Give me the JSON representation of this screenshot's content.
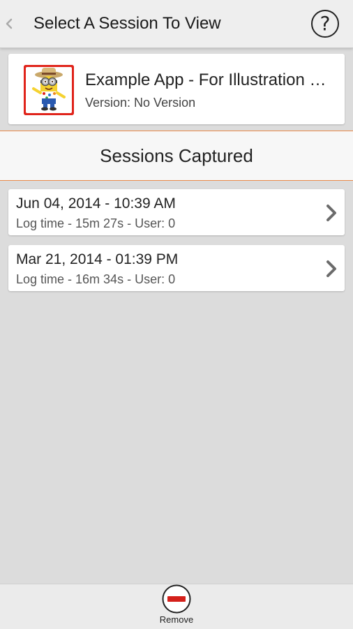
{
  "header": {
    "title": "Select A Session To View",
    "help_label": "?",
    "back_icon": "chevron-left-icon"
  },
  "app": {
    "name": "Example App - For Illustration Purposes",
    "version": "Version: No Version",
    "icon": "app-minion-icon"
  },
  "sessions_section": {
    "title": "Sessions Captured"
  },
  "sessions": [
    {
      "date": "Jun 04, 2014 - 10:39 AM",
      "detail": "Log time - 15m 27s - User: 0"
    },
    {
      "date": "Mar 21, 2014 - 01:39 PM",
      "detail": "Log time - 16m 34s - User: 0"
    }
  ],
  "bottom_bar": {
    "remove_label": "Remove",
    "remove_icon": "remove-circle-icon"
  },
  "colors": {
    "accent_orange": "#e88a4a",
    "remove_red": "#d4201a",
    "app_icon_red": "#e0241b",
    "background": "#dcdcdc"
  }
}
